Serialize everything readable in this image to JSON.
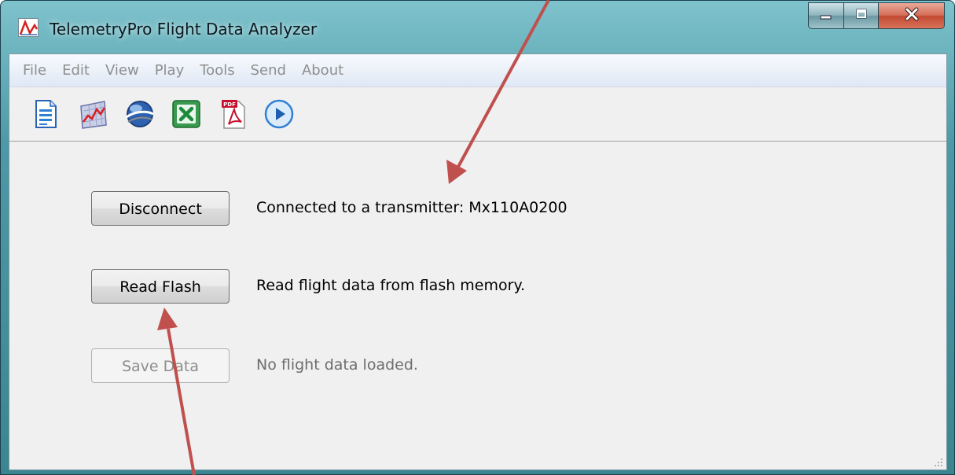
{
  "window": {
    "title": "TelemetryPro Flight Data Analyzer",
    "caption_buttons": [
      "minimize-icon",
      "maximize-icon",
      "close-icon"
    ]
  },
  "menu": [
    "File",
    "Edit",
    "View",
    "Play",
    "Tools",
    "Send",
    "About"
  ],
  "toolbar": {
    "icons": [
      "new-document-icon",
      "chart-icon",
      "google-earth-icon",
      "excel-icon",
      "pdf-icon",
      "play-icon"
    ],
    "pdf_icon_label": "PDF"
  },
  "rows": [
    {
      "button": "Disconnect",
      "status": "Connected to a transmitter: Mx110A0200",
      "enabled": true
    },
    {
      "button": "Read Flash",
      "status": "Read flight data from flash memory.",
      "enabled": true
    },
    {
      "button": "Save Data",
      "status": "No flight data loaded.",
      "enabled": false
    }
  ],
  "colors": {
    "frame_glass": "#4d9aa6",
    "client_bg": "#f0f0f0",
    "annotation_arrow": "#c0504d",
    "play_blue": "#2f7fd3",
    "excel_green": "#1e8a3b",
    "pdf_red": "#c8102e"
  }
}
